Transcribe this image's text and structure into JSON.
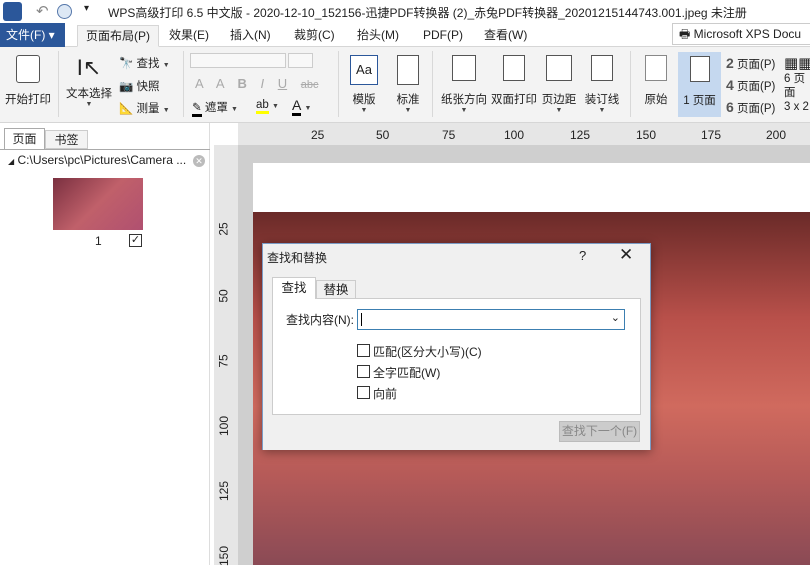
{
  "title": "WPS高级打印 6.5 中文版 - 2020-12-10_152156-迅捷PDF转换器 (2)_赤兔PDF转换器_20201215144743.001.jpeg 未注册",
  "tabs": {
    "file": "文件(F)",
    "items": [
      "页面布局(P)",
      "效果(E)",
      "插入(N)",
      "裁剪(C)",
      "抬头(M)",
      "PDF(P)",
      "查看(W)"
    ]
  },
  "printer": "Microsoft XPS Docu",
  "ribbon": {
    "start_print": "开始打印",
    "text_select": "文本选择",
    "find": "查找",
    "snapshot": "快照",
    "measure": "测量",
    "mask": "遮罩",
    "template": "模版",
    "standard": "标准",
    "paper_dir": "纸张方向",
    "duplex": "双面打印",
    "margin": "页边距",
    "binding": "装订线",
    "original": "原始",
    "one_page": "1 页面",
    "two_page": "页面(P)",
    "four_page": "页面(P)",
    "six_page": "页面(P)",
    "n2": "2",
    "n4": "4",
    "n6": "6",
    "six_grid": "6 页面",
    "grid32": "3 x 2",
    "bold": "B",
    "italic": "I",
    "underline": "U",
    "strike": "abc"
  },
  "left_panel": {
    "tabs": [
      "页面",
      "书签"
    ],
    "path": "C:\\Users\\pc\\Pictures\\Camera ...",
    "page_num": "1"
  },
  "hruler": [
    "25",
    "50",
    "75",
    "100",
    "125",
    "150",
    "175",
    "200"
  ],
  "vruler": [
    "25",
    "50",
    "75",
    "100",
    "125",
    "150"
  ],
  "dialog": {
    "title": "查找和替换",
    "help": "?",
    "tabs": [
      "查找",
      "替换"
    ],
    "find_label": "查找内容(N):",
    "find_value": "",
    "options": [
      "匹配(区分大小写)(C)",
      "全字匹配(W)",
      "向前"
    ],
    "find_next": "查找下一个(F)"
  },
  "colors": {
    "accent": "#2b579a"
  }
}
